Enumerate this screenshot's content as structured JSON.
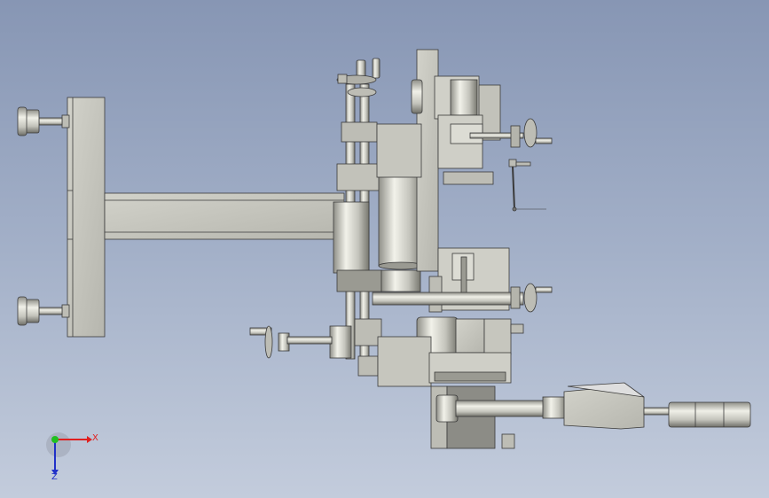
{
  "triad": {
    "x_label": "X",
    "z_label": "Z",
    "x_color": "#e02020",
    "z_color": "#2030c8",
    "y_color": "#20c020"
  },
  "model": {
    "part_fill": "#c9c9c0",
    "part_stroke": "#3a3a3a",
    "dark_fill": "#8a8a84",
    "light_fill": "#e6e6de"
  }
}
